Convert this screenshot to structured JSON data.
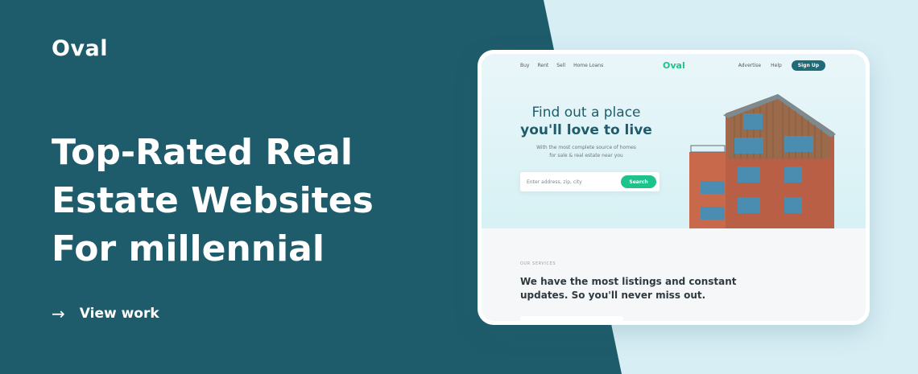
{
  "brand": {
    "name": "Oval"
  },
  "headline": {
    "line1": "Top-Rated Real",
    "line2": "Estate Websites",
    "line3": "For millennial"
  },
  "cta": {
    "arrow": "→",
    "label": "View  work"
  },
  "mockup": {
    "nav_left": [
      "Buy",
      "Rent",
      "Sell",
      "Home Loans"
    ],
    "logo": "Oval",
    "nav_right": [
      "Advertise",
      "Help"
    ],
    "signup_label": "Sign Up",
    "hero_title_line1": "Find out a place",
    "hero_title_line2": "you'll love to live",
    "hero_sub_line1": "With the most complete source of homes",
    "hero_sub_line2": "for sale & real estate near you",
    "search_placeholder": "Enter address, zip, city",
    "search_button": "Search",
    "services_eyebrow": "OUR SERVICES",
    "services_heading_line1": "We have the most listings and constant",
    "services_heading_line2": "updates. So you'll never miss out."
  },
  "colors": {
    "dark_teal": "#1f5c6b",
    "light_panel": "#d8eef5",
    "accent_green": "#1ec28b",
    "signup_bg": "#1f6b78"
  },
  "icons": {
    "cta": "arrow-right-icon"
  }
}
